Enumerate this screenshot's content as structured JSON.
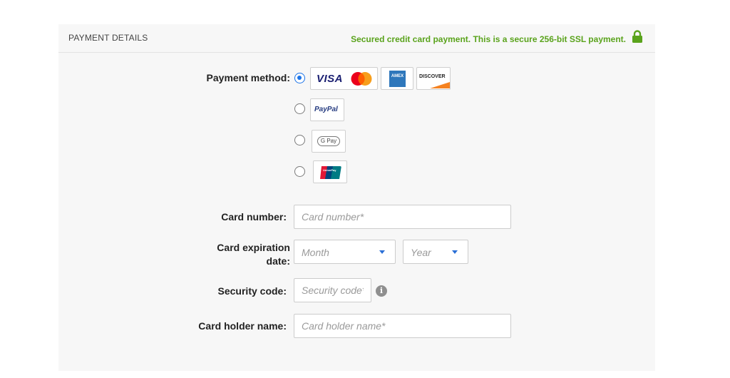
{
  "header": {
    "title": "PAYMENT DETAILS",
    "secure_text": "Secured credit card payment. This is a secure 256-bit SSL payment."
  },
  "payment_method": {
    "label": "Payment method:",
    "options": [
      {
        "name": "Credit cards",
        "selected": true,
        "brands": [
          "VISA",
          "Mastercard",
          "AMEX",
          "DISCOVER"
        ]
      },
      {
        "name": "PayPal",
        "selected": false,
        "text": "PayPal"
      },
      {
        "name": "Google Pay",
        "selected": false,
        "text": "G Pay"
      },
      {
        "name": "UnionPay",
        "selected": false,
        "text": "UnionPay"
      }
    ]
  },
  "card_number": {
    "label": "Card number:",
    "placeholder": "Card number*"
  },
  "expiration": {
    "label_line1": "Card expiration",
    "label_line2": "date:",
    "month_placeholder": "Month",
    "year_placeholder": "Year"
  },
  "security_code": {
    "label": "Security code:",
    "placeholder": "Security code*"
  },
  "holder_name": {
    "label": "Card holder name:",
    "placeholder": "Card holder name*"
  },
  "colors": {
    "accent": "#1a73e8",
    "secure_green": "#5aa31c",
    "panel_bg": "#f7f7f7"
  }
}
